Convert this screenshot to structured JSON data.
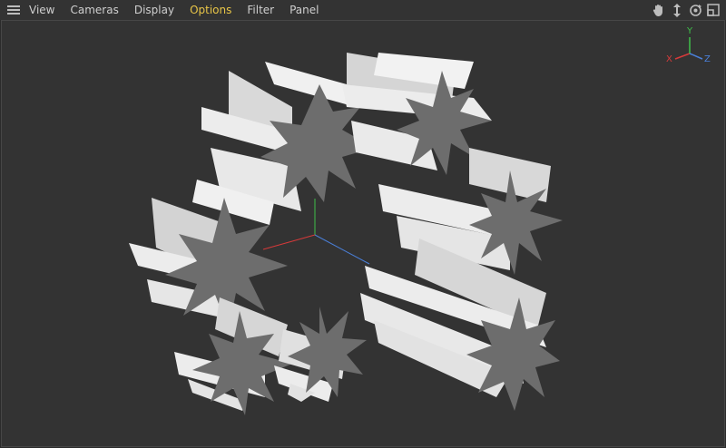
{
  "menu": {
    "items": [
      {
        "label": "View"
      },
      {
        "label": "Cameras"
      },
      {
        "label": "Display"
      },
      {
        "label": "Options",
        "active": true
      },
      {
        "label": "Filter"
      },
      {
        "label": "Panel"
      }
    ]
  },
  "toolbar": {
    "icons": [
      "hand-pan-icon",
      "move-arrows-icon",
      "orbit-icon",
      "maximize-view-icon"
    ]
  },
  "gizmo": {
    "x_label": "X",
    "y_label": "Y",
    "z_label": "Z",
    "x_color": "#d63a3a",
    "y_color": "#3fbf4a",
    "z_color": "#4a7fd8"
  },
  "colors": {
    "active_menu": "#e8c547",
    "viewport_bg": "#333333",
    "object_light": "#e6e6e6",
    "object_dark": "#6f6f6f"
  }
}
